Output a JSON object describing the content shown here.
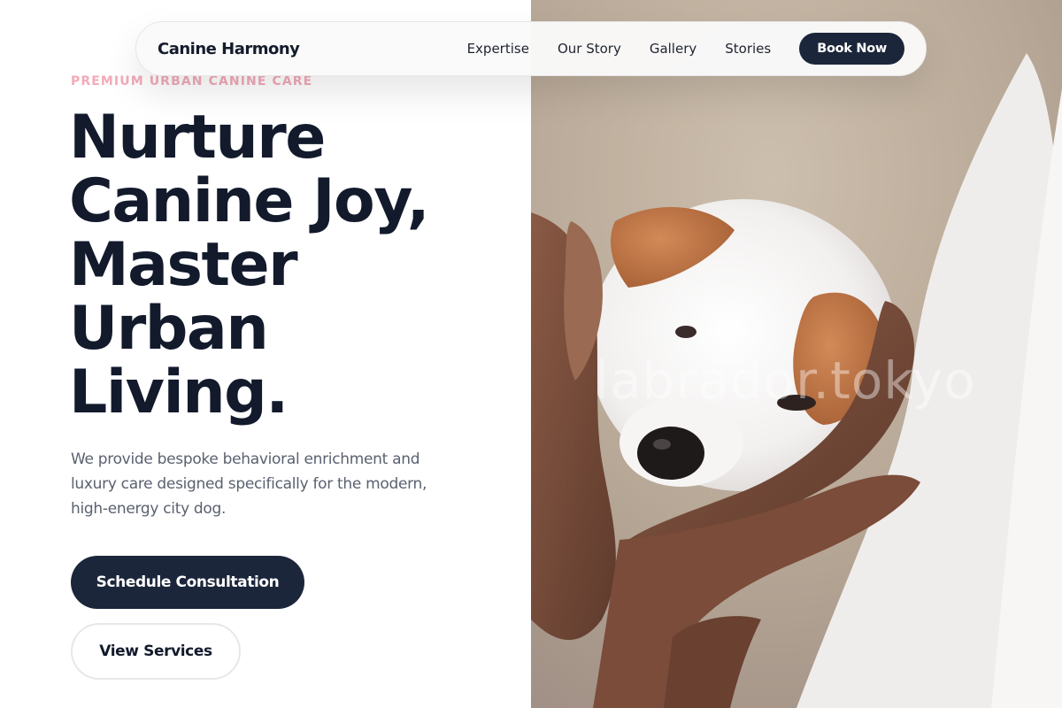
{
  "nav": {
    "brand": "Canine Harmony",
    "links": [
      "Expertise",
      "Our Story",
      "Gallery",
      "Stories"
    ],
    "cta_label": "Book Now"
  },
  "hero": {
    "eyebrow": "PREMIUM URBAN CANINE CARE",
    "headline_lines": [
      "Nurture",
      "Canine Joy,",
      "Master",
      "Urban",
      "Living."
    ],
    "lede": "We provide bespoke behavioral enrichment and luxury care designed specifically for the modern, high-energy city dog.",
    "primary_button": "Schedule Consultation",
    "secondary_button": "View Services"
  },
  "photo": {
    "subject": "puppy-held-in-hands-image",
    "watermark": "labrador.tokyo"
  },
  "colors": {
    "navy": "#1c263a",
    "headline": "#121a2c",
    "eyebrow_pink": "#f2aab9",
    "body_gray": "#5a6170"
  }
}
